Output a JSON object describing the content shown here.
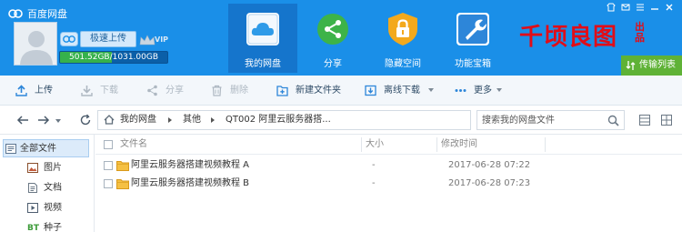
{
  "app": {
    "title": "百度网盘",
    "upload_label": "极速上传",
    "vip_label": "VIP",
    "storage_text": "501.52GB/1031.00GB",
    "storage_used_fraction": 0.486
  },
  "nav_tabs": [
    {
      "label": "我的网盘",
      "icon": "cloud-drive-icon",
      "active": true
    },
    {
      "label": "分享",
      "icon": "share-icon",
      "active": false
    },
    {
      "label": "隐藏空间",
      "icon": "lock-icon",
      "active": false
    },
    {
      "label": "功能宝箱",
      "icon": "wrench-icon",
      "active": false
    }
  ],
  "watermark": {
    "main": "千顷良图",
    "small": "出品"
  },
  "transfer_label": "传输列表",
  "toolbar": {
    "upload": "上传",
    "download": "下载",
    "share": "分享",
    "delete": "删除",
    "new_folder": "新建文件夹",
    "offline_download": "离线下载",
    "more": "更多"
  },
  "breadcrumb": {
    "items": [
      "我的网盘",
      "其他",
      "QT002 阿里云服务器搭..."
    ]
  },
  "search": {
    "placeholder": "搜索我的网盘文件"
  },
  "sidebar": {
    "items": [
      {
        "label": "全部文件",
        "icon": "all-files-icon",
        "active": true
      },
      {
        "label": "图片",
        "icon": "image-icon",
        "active": false
      },
      {
        "label": "文档",
        "icon": "document-icon",
        "active": false
      },
      {
        "label": "视频",
        "icon": "video-icon",
        "active": false
      },
      {
        "label": "种子",
        "icon": "bt-seed-icon",
        "active": false
      }
    ],
    "bt_badge": "BT"
  },
  "file_list": {
    "columns": [
      "文件名",
      "大小",
      "修改时间"
    ],
    "rows": [
      {
        "name": "阿里云服务器搭建视频教程 A",
        "size": "-",
        "modified": "2017-06-28 07:22"
      },
      {
        "name": "阿里云服务器搭建视频教程 B",
        "size": "-",
        "modified": "2017-06-28 07:23"
      }
    ]
  },
  "colors": {
    "header_blue": "#1a8fe8",
    "active_tab": "#1575cc",
    "transfer_green": "#5fb236",
    "watermark_red": "#e10d18",
    "folder_yellow": "#f5c043"
  }
}
